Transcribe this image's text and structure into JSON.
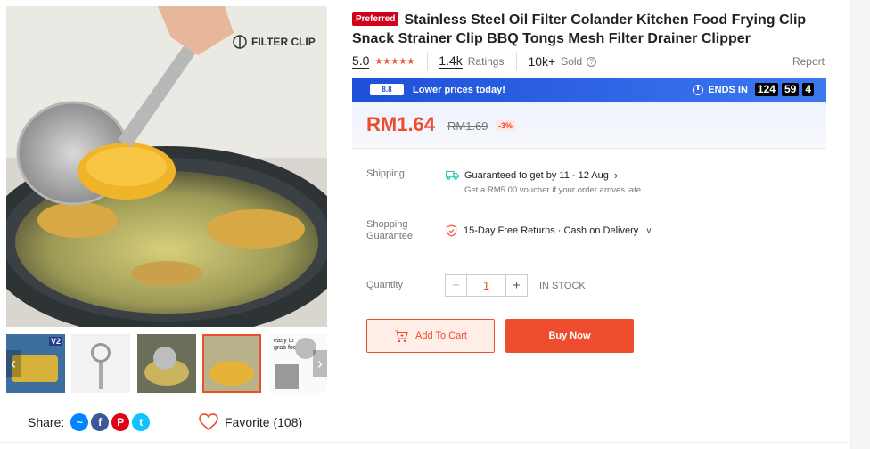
{
  "gallery": {
    "main_watermark": "FILTER CLIP",
    "thumb_labels": [
      "V2",
      "",
      "",
      "",
      "easy to grab food"
    ]
  },
  "share": {
    "label": "Share:",
    "icons": [
      "messenger-icon",
      "facebook-icon",
      "pinterest-icon",
      "twitter-icon"
    ]
  },
  "favorite": {
    "label": "Favorite (108)"
  },
  "product": {
    "badge": "Preferred",
    "title": "Stainless Steel Oil Filter Colander Kitchen Food Frying Clip Snack Strainer Clip BBQ Tongs Mesh Filter Drainer Clipper",
    "rating": "5.0",
    "ratings_count": "1.4k",
    "ratings_label": "Ratings",
    "sold_count": "10k+",
    "sold_label": "Sold",
    "report": "Report"
  },
  "flash": {
    "logo": "8.8",
    "text": "Lower prices today!",
    "ends_label": "ENDS IN",
    "timer": [
      "124",
      "59",
      "4"
    ]
  },
  "price": {
    "current": "RM1.64",
    "original": "RM1.69",
    "discount": "-3%"
  },
  "shipping": {
    "label": "Shipping",
    "line": "Guaranteed to get by 11 - 12 Aug",
    "sub": "Get a RM5.00 voucher if your order arrives late."
  },
  "guarantee": {
    "label_1": "Shopping",
    "label_2": "Guarantee",
    "text": "15-Day Free Returns · Cash on Delivery"
  },
  "quantity": {
    "label": "Quantity",
    "value": "1",
    "minus": "−",
    "plus": "+",
    "stock": "IN STOCK"
  },
  "actions": {
    "add_to_cart": "Add To Cart",
    "buy_now": "Buy Now"
  },
  "colors": {
    "accent": "#ee4d2d",
    "flash_blue": "#1f4fd8"
  }
}
